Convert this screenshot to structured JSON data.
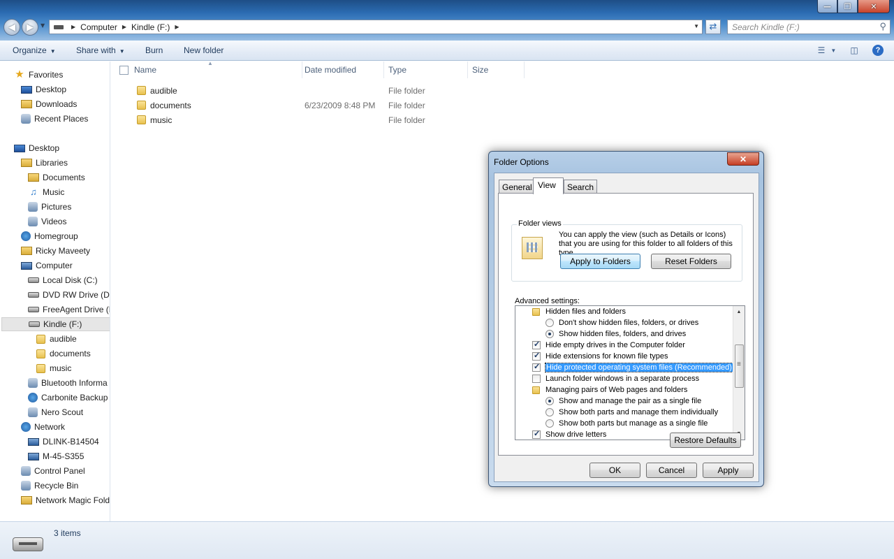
{
  "window": {
    "controls": {
      "minimize": "—",
      "maximize": "❒",
      "close": "✕"
    }
  },
  "address": {
    "segments": [
      "Computer",
      "Kindle (F:)"
    ],
    "search_placeholder": "Search Kindle (F:)"
  },
  "toolbar": {
    "organize": "Organize",
    "share_with": "Share with",
    "burn": "Burn",
    "new_folder": "New folder"
  },
  "nav": {
    "favorites": "Favorites",
    "desktop_fav": "Desktop",
    "downloads": "Downloads",
    "recent_places": "Recent Places",
    "desktop": "Desktop",
    "libraries": "Libraries",
    "documents": "Documents",
    "music": "Music",
    "pictures": "Pictures",
    "videos": "Videos",
    "homegroup": "Homegroup",
    "user": "Ricky Maveety",
    "computer": "Computer",
    "local_disk": "Local Disk (C:)",
    "dvd": "DVD RW Drive (D:)",
    "freeagent": "FreeAgent Drive (E",
    "kindle": "Kindle (F:)",
    "audible": "audible",
    "kdocuments": "documents",
    "kmusic": "music",
    "bluetooth": "Bluetooth Informa",
    "carbonite": "Carbonite Backup",
    "nero": "Nero Scout",
    "network": "Network",
    "dlink": "DLINK-B14504",
    "m45": "M-45-S355",
    "control_panel": "Control Panel",
    "recycle": "Recycle Bin",
    "netmagic": "Network Magic Fold"
  },
  "columns": {
    "name": "Name",
    "date": "Date modified",
    "type": "Type",
    "size": "Size"
  },
  "files": [
    {
      "name": "audible",
      "date": "",
      "type": "File folder"
    },
    {
      "name": "documents",
      "date": "6/23/2009 8:48 PM",
      "type": "File folder"
    },
    {
      "name": "music",
      "date": "",
      "type": "File folder"
    }
  ],
  "status": {
    "items": "3 items"
  },
  "dialog": {
    "title": "Folder Options",
    "close": "✕",
    "tabs": [
      "General",
      "View",
      "Search"
    ],
    "folder_views_label": "Folder views",
    "folder_views_text": "You can apply the view (such as Details or Icons) that you are using for this folder to all folders of this type.",
    "apply_to_folders": "Apply to Folders",
    "reset_folders": "Reset Folders",
    "advanced_label": "Advanced settings:",
    "advanced": [
      {
        "kind": "folder",
        "label": "Hidden files and folders"
      },
      {
        "kind": "radio",
        "checked": false,
        "label": "Don't show hidden files, folders, or drives"
      },
      {
        "kind": "radio",
        "checked": true,
        "label": "Show hidden files, folders, and drives"
      },
      {
        "kind": "check",
        "checked": true,
        "label": "Hide empty drives in the Computer folder"
      },
      {
        "kind": "check",
        "checked": true,
        "label": "Hide extensions for known file types"
      },
      {
        "kind": "check",
        "checked": true,
        "label": "Hide protected operating system files (Recommended)"
      },
      {
        "kind": "check",
        "checked": false,
        "label": "Launch folder windows in a separate process"
      },
      {
        "kind": "folder",
        "label": "Managing pairs of Web pages and folders"
      },
      {
        "kind": "radio",
        "checked": true,
        "label": "Show and manage the pair as a single file"
      },
      {
        "kind": "radio",
        "checked": false,
        "label": "Show both parts and manage them individually"
      },
      {
        "kind": "radio",
        "checked": false,
        "label": "Show both parts but manage as a single file"
      },
      {
        "kind": "check",
        "checked": true,
        "label": "Show drive letters"
      }
    ],
    "restore_defaults": "Restore Defaults",
    "ok": "OK",
    "cancel": "Cancel",
    "apply": "Apply"
  }
}
